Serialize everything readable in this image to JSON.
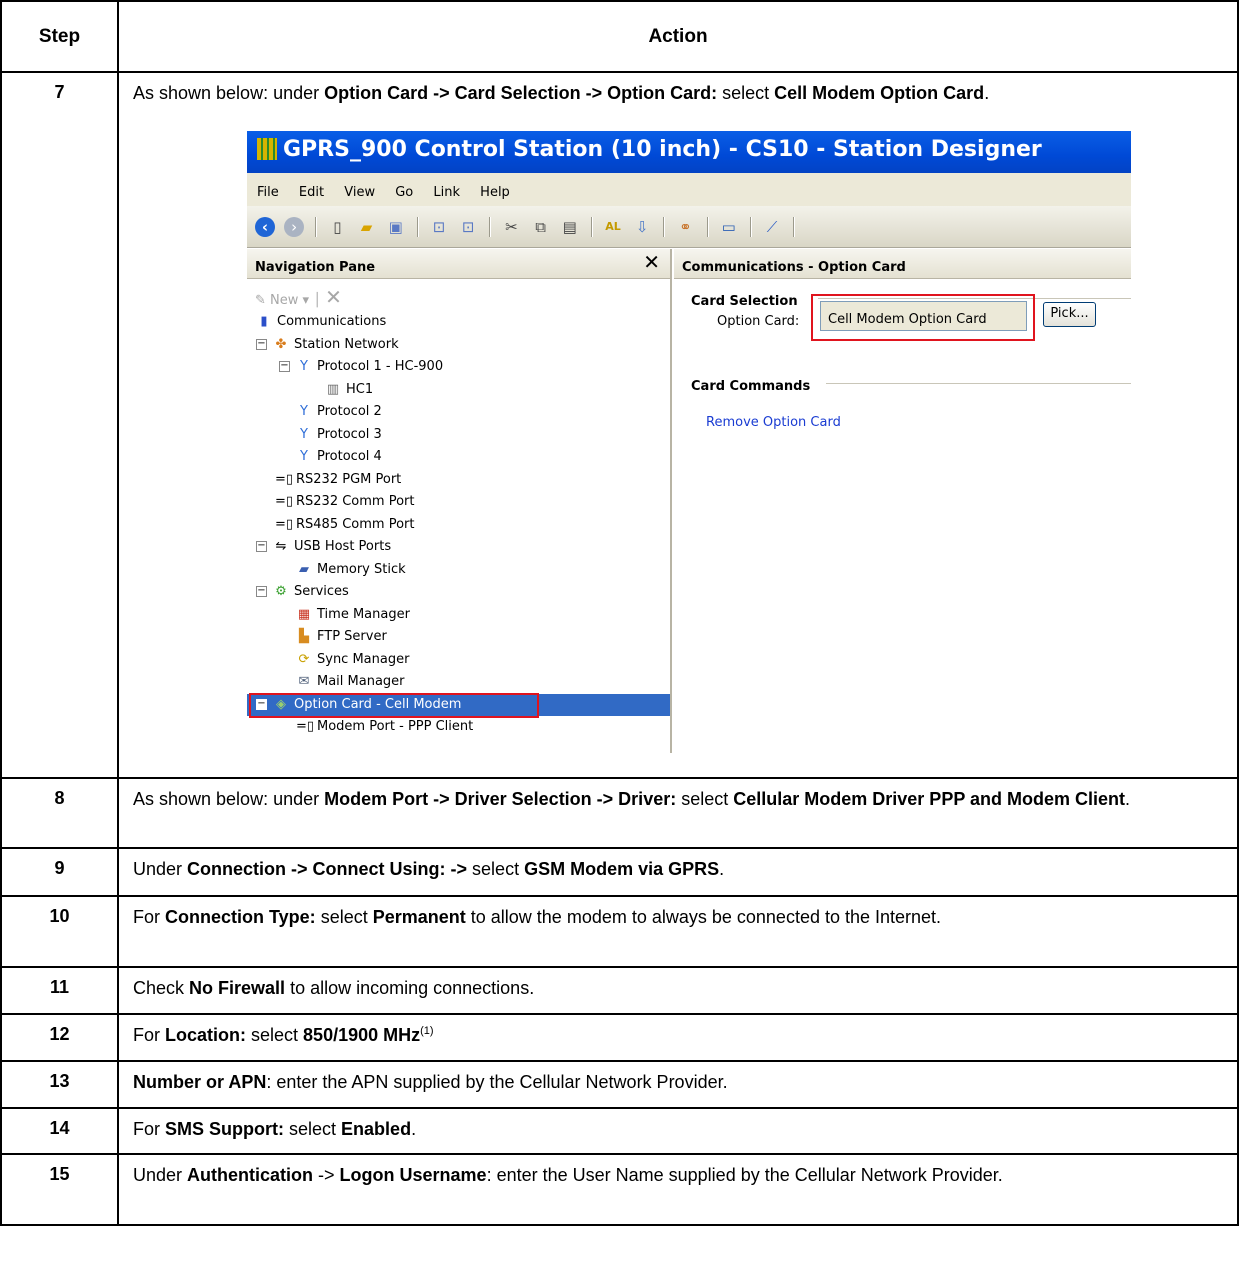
{
  "table": {
    "header_step": "Step",
    "header_action": "Action"
  },
  "steps": [
    {
      "num": "7",
      "parts": [
        "As shown below: under ",
        "Option Card -> Card Selection -> Option Card:",
        " select ",
        "Cell Modem Option Card",
        "."
      ]
    },
    {
      "num": "8",
      "parts": [
        "As shown below: under ",
        "Modem Port -> Driver Selection -> Driver:",
        " select ",
        "Cellular Modem Driver PPP and Modem Client",
        "."
      ]
    },
    {
      "num": "9",
      "parts": [
        "Under ",
        "Connection -> Connect Using: ->",
        " select ",
        "GSM Modem via GPRS",
        "."
      ]
    },
    {
      "num": "10",
      "parts": [
        "For ",
        "Connection Type:",
        " select ",
        "Permanent",
        " to allow the modem to always be connected to the Internet."
      ]
    },
    {
      "num": "11",
      "parts": [
        "Check ",
        "No Firewall",
        " to allow incoming connections."
      ]
    },
    {
      "num": "12",
      "parts": [
        "For ",
        "Location:",
        " select ",
        "850/1900 MHz",
        ""
      ],
      "sup": "(1)"
    },
    {
      "num": "13",
      "parts": [
        "",
        "Number or APN",
        ": enter the APN supplied by the Cellular Network Provider."
      ]
    },
    {
      "num": "14",
      "parts": [
        "For ",
        "SMS Support:",
        " select ",
        "Enabled",
        "."
      ]
    },
    {
      "num": "15",
      "parts": [
        "Under ",
        "Authentication",
        " -> ",
        "Logon Username",
        ":  enter the User Name supplied by the Cellular Network Provider."
      ]
    }
  ],
  "screenshot": {
    "title": "GPRS_900 Control Station (10 inch) - CS10 - Station Designer",
    "menu": [
      "File",
      "Edit",
      "View",
      "Go",
      "Link",
      "Help"
    ],
    "nav_pane_title": "Navigation Pane",
    "new_button": "New",
    "tree": [
      {
        "label": "Communications",
        "icon": "communications-icon"
      },
      {
        "label": "Station Network",
        "icon": "network-icon"
      },
      {
        "label": "Protocol 1 - HC-900",
        "icon": "protocol-icon"
      },
      {
        "label": "HC1",
        "icon": "controller-icon"
      },
      {
        "label": "Protocol 2",
        "icon": "protocol-icon"
      },
      {
        "label": "Protocol 3",
        "icon": "protocol-icon"
      },
      {
        "label": "Protocol 4",
        "icon": "protocol-icon"
      },
      {
        "label": "RS232 PGM Port",
        "icon": "port-icon"
      },
      {
        "label": "RS232 Comm Port",
        "icon": "port-icon"
      },
      {
        "label": "RS485 Comm Port",
        "icon": "port-icon"
      },
      {
        "label": "USB Host Ports",
        "icon": "usb-icon"
      },
      {
        "label": "Memory Stick",
        "icon": "memory-stick-icon"
      },
      {
        "label": "Services",
        "icon": "services-icon"
      },
      {
        "label": "Time Manager",
        "icon": "calendar-icon"
      },
      {
        "label": "FTP Server",
        "icon": "folder-icon"
      },
      {
        "label": "Sync Manager",
        "icon": "sync-icon"
      },
      {
        "label": "Mail Manager",
        "icon": "mail-icon"
      },
      {
        "label": "Option Card - Cell Modem",
        "icon": "card-icon"
      },
      {
        "label": "Modem Port - PPP Client",
        "icon": "port-icon"
      }
    ],
    "content_title": "Communications - Option Card",
    "card_selection": "Card Selection",
    "option_card_label": "Option Card:",
    "option_card_value": "Cell Modem Option Card",
    "pick_button": "Pick...",
    "card_commands": "Card Commands",
    "remove_link": "Remove Option Card"
  },
  "colors": {
    "titlebar": "#0049d6",
    "selection": "#316ac5",
    "highlight_box": "#e0141e"
  }
}
